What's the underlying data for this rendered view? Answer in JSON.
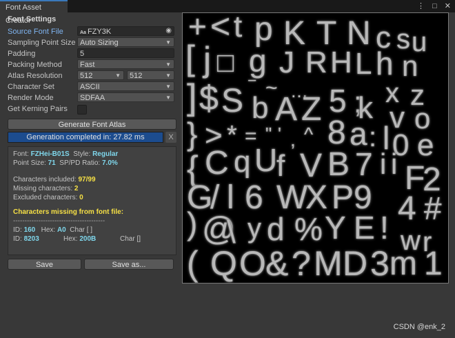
{
  "window": {
    "tab_title": "Font Asset Creator",
    "icons": [
      "more-icon",
      "maximize-icon",
      "close-icon"
    ]
  },
  "settings": {
    "section_title": "Font Settings",
    "source_font_file": {
      "label": "Source Font File",
      "value": "FZY3K",
      "icon": "font-asset-icon"
    },
    "sampling_point_size": {
      "label": "Sampling Point Size",
      "value": "Auto Sizing"
    },
    "padding": {
      "label": "Padding",
      "value": "5"
    },
    "packing_method": {
      "label": "Packing Method",
      "value": "Fast"
    },
    "atlas_resolution": {
      "label": "Atlas Resolution",
      "width": "512",
      "height": "512"
    },
    "character_set": {
      "label": "Character Set",
      "value": "ASCII"
    },
    "render_mode": {
      "label": "Render Mode",
      "value": "SDFAA"
    },
    "kerning": {
      "label": "Get Kerning Pairs",
      "checked": false
    }
  },
  "actions": {
    "generate_label": "Generate Font Atlas",
    "progress_text": "Generation completed in: 27.82 ms",
    "progress": 1.0,
    "cancel_label": "X",
    "save_label": "Save",
    "save_as_label": "Save as..."
  },
  "info": {
    "font_prefix": "Font: ",
    "font_name": "FZHei-B01S",
    "style_prefix": "Style: ",
    "style_value": "Regular",
    "point_size_prefix": "Point Size: ",
    "point_size_value": "71",
    "ratio_prefix": "SP/PD Ratio: ",
    "ratio_value": "7.0%",
    "included_prefix": "Characters included: ",
    "included_value": "97/99",
    "missing_prefix": "Missing characters: ",
    "missing_value": "2",
    "excluded_prefix": "Excluded characters: ",
    "excluded_value": "0",
    "missing_title": "Characters missing from font file:",
    "divider": "----------------------------------------",
    "missing_rows": [
      {
        "id_prefix": "ID: ",
        "id": "160",
        "hex_prefix": "Hex: ",
        "hex": "A0",
        "char": "Char [ ]"
      },
      {
        "id_prefix": "ID: ",
        "id": "8203",
        "hex_prefix": "Hex: ",
        "hex": "200B",
        "char": "Char []"
      }
    ]
  },
  "atlas_glyphs": [
    "+",
    "<",
    "t",
    "p",
    "K",
    "T",
    "N",
    "c",
    "s",
    "u",
    "[",
    "j",
    "□",
    "g",
    "J",
    "R",
    "H",
    "L",
    "h",
    "n",
    "]",
    "$",
    "S",
    "‾",
    "~",
    "…",
    "5",
    ";",
    "x",
    "z",
    "b",
    "A",
    "Z",
    "k",
    "v",
    "o",
    "}",
    ">",
    "*",
    "=",
    "\"",
    "'",
    ",",
    "^",
    "8",
    "a",
    ":",
    "l",
    "0",
    "e",
    "{",
    "C",
    "q",
    "U",
    "f",
    "V",
    "B",
    "7",
    "i",
    "i",
    "G",
    "/",
    "l",
    "6",
    "W",
    "X",
    "P",
    "9",
    "F",
    "2",
    ")",
    "@",
    "\\",
    "y",
    "d",
    "%",
    "Y",
    "E",
    "!",
    "4",
    "#",
    "w",
    "r",
    "(",
    "Q",
    "O",
    "&",
    "?",
    "M",
    "D",
    "3",
    "m",
    "1"
  ],
  "watermark": "CSDN @enk_2"
}
